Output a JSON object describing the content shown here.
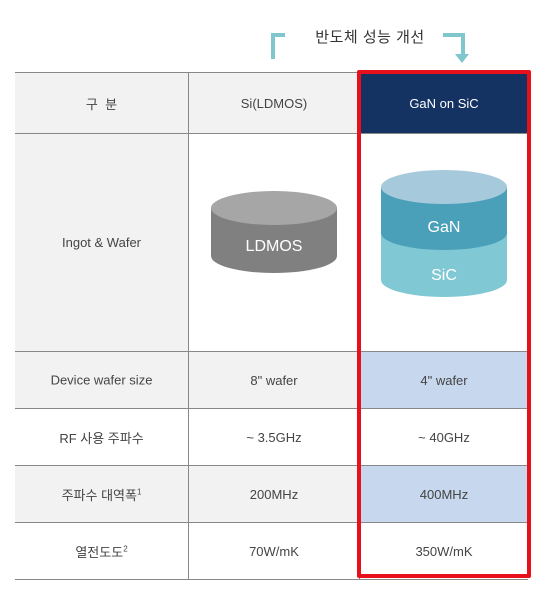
{
  "banner": {
    "title": "반도체 성능 개선",
    "arrow_color": "#7fc6cf"
  },
  "table": {
    "headers": [
      "구  분",
      "Si(LDMOS)",
      "GaN on SiC"
    ],
    "image_row": {
      "label": "Ingot & Wafer",
      "ldmos_label": "LDMOS",
      "gan_layer_label": "GaN",
      "sic_layer_label": "SiC"
    },
    "rows": [
      {
        "label": "Device wafer size",
        "footnote": "",
        "si": "8\" wafer",
        "gan": "4\" wafer"
      },
      {
        "label": "RF 사용 주파수",
        "footnote": "",
        "si": "~ 3.5GHz",
        "gan": "~ 40GHz"
      },
      {
        "label": "주파수 대역폭",
        "footnote": "1",
        "si": "200MHz",
        "gan": "400MHz"
      },
      {
        "label": "열전도도",
        "footnote": "2",
        "si": "70W/mK",
        "gan": "350W/mK"
      }
    ]
  },
  "colors": {
    "header_navy": "#143363",
    "highlight_red": "#e8101a",
    "highlight_cell": "#c6d7ee",
    "ldmos_gray": "#808080",
    "gan_teal": "#4aa0b8",
    "sic_light_teal": "#80c8d4"
  }
}
